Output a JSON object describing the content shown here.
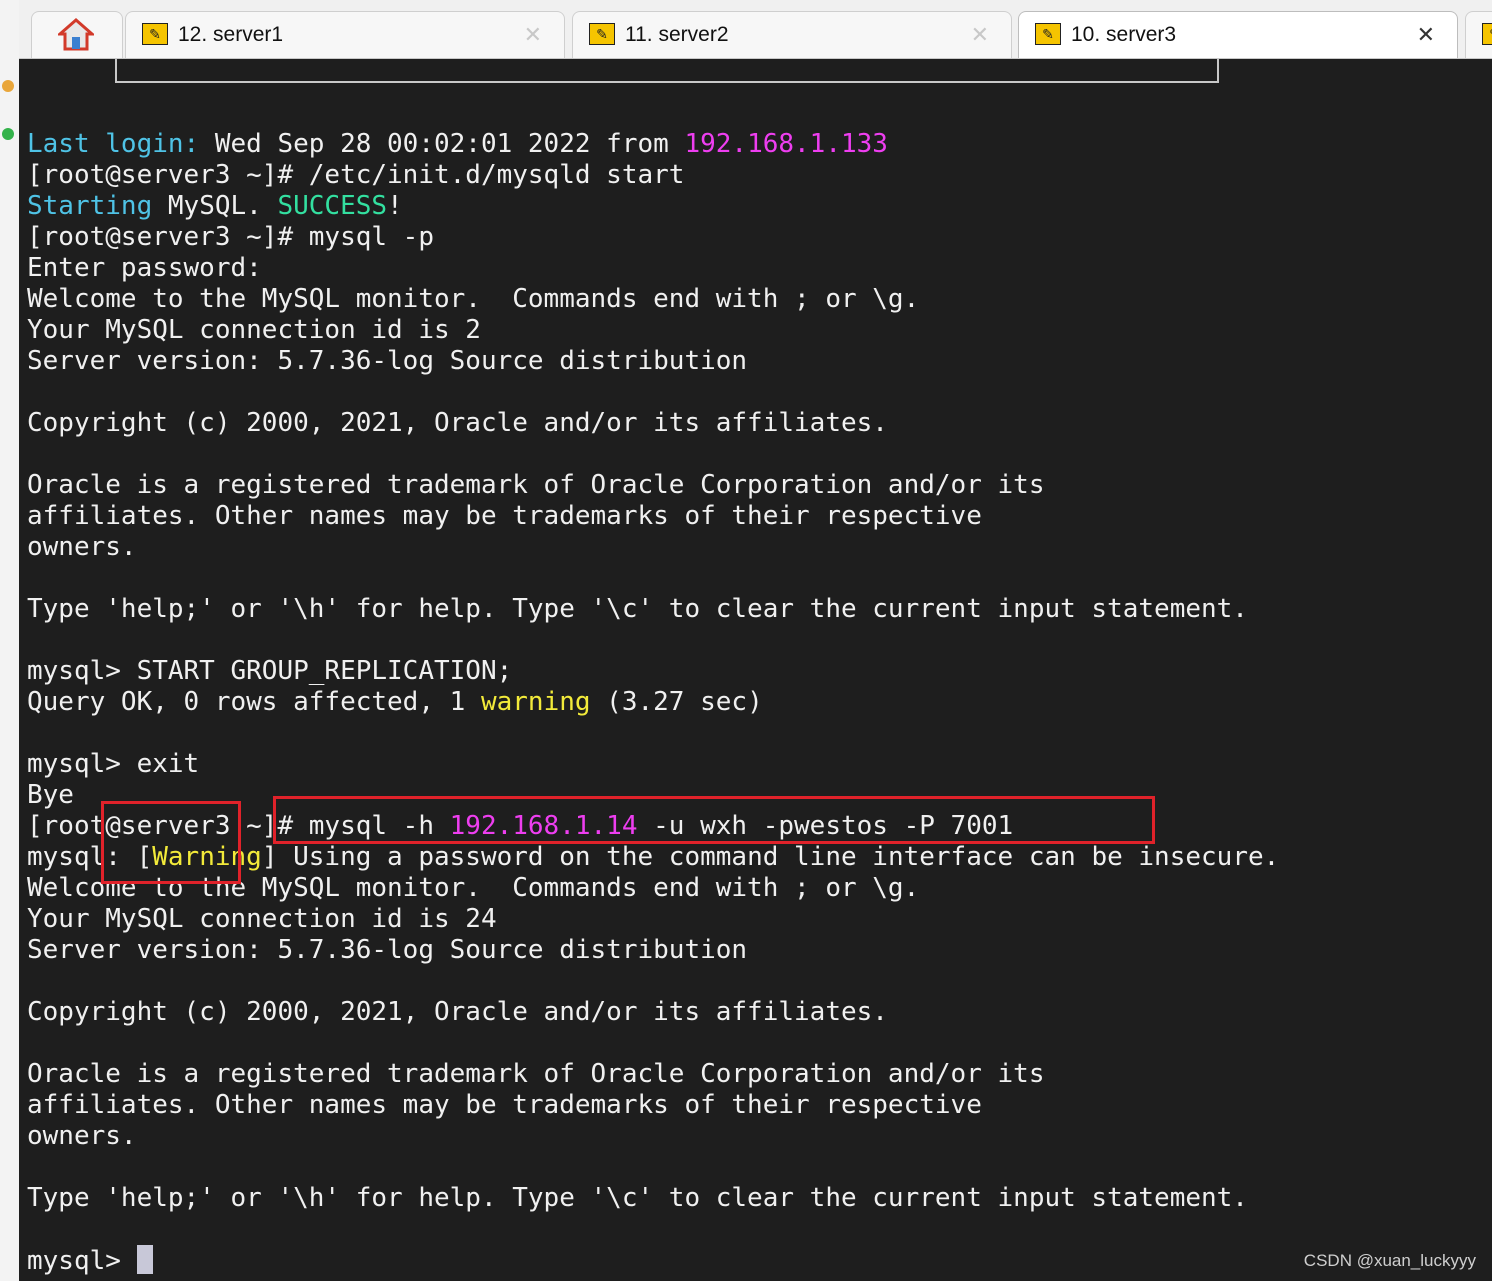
{
  "tabs": [
    {
      "label": "12. server1",
      "active": false
    },
    {
      "label": "11. server2",
      "active": false
    },
    {
      "label": "10. server3",
      "active": true
    }
  ],
  "icons": {
    "home": "home-icon",
    "tab": "key-icon",
    "close": "close-icon"
  },
  "colors": {
    "terminal_bg": "#1e1e1e",
    "text": "#f0f0f0",
    "cyan": "#4fc3e6",
    "magenta": "#ee3ef0",
    "green": "#33e0a0",
    "yellow": "#f2ea3a",
    "highlight": "#e0222a"
  },
  "terminal": {
    "lines": [
      [
        {
          "t": "Last login:",
          "c": "cyan"
        },
        {
          "t": " Wed Sep 28 00:02:01 2022 from "
        },
        {
          "t": "192.168.1.133",
          "c": "magenta"
        }
      ],
      [
        {
          "t": "[root@server3 ~]# /etc/init.d/mysqld start"
        }
      ],
      [
        {
          "t": "Starting",
          "c": "cyan"
        },
        {
          "t": " MySQL. "
        },
        {
          "t": "SUCCESS",
          "c": "green"
        },
        {
          "t": "!"
        }
      ],
      [
        {
          "t": "[root@server3 ~]# mysql -p"
        }
      ],
      [
        {
          "t": "Enter password:"
        }
      ],
      [
        {
          "t": "Welcome to the MySQL monitor.  Commands end with ; or \\g."
        }
      ],
      [
        {
          "t": "Your MySQL connection id is 2"
        }
      ],
      [
        {
          "t": "Server version: 5.7.36-log Source distribution"
        }
      ],
      [
        {
          "t": ""
        }
      ],
      [
        {
          "t": "Copyright (c) 2000, 2021, Oracle and/or its affiliates."
        }
      ],
      [
        {
          "t": ""
        }
      ],
      [
        {
          "t": "Oracle is a registered trademark of Oracle Corporation and/or its"
        }
      ],
      [
        {
          "t": "affiliates. Other names may be trademarks of their respective"
        }
      ],
      [
        {
          "t": "owners."
        }
      ],
      [
        {
          "t": ""
        }
      ],
      [
        {
          "t": "Type 'help;' or '\\h' for help. Type '\\c' to clear the current input statement."
        }
      ],
      [
        {
          "t": ""
        }
      ],
      [
        {
          "t": "mysql> START GROUP_REPLICATION;"
        }
      ],
      [
        {
          "t": "Query OK, 0 rows affected, 1 "
        },
        {
          "t": "warning",
          "c": "yellow"
        },
        {
          "t": " (3.27 sec)"
        }
      ],
      [
        {
          "t": ""
        }
      ],
      [
        {
          "t": "mysql> exit"
        }
      ],
      [
        {
          "t": "Bye"
        }
      ],
      [
        {
          "t": "[root@server3 ~]# mysql -h "
        },
        {
          "t": "192.168.1.14",
          "c": "magenta"
        },
        {
          "t": " -u wxh -pwestos -P 7001"
        }
      ],
      [
        {
          "t": "mysql: ["
        },
        {
          "t": "Warning",
          "c": "yellow"
        },
        {
          "t": "] Using a password on the command line interface can be insecure."
        }
      ],
      [
        {
          "t": "Welcome to the MySQL monitor.  Commands end with ; or \\g."
        }
      ],
      [
        {
          "t": "Your MySQL connection id is 24"
        }
      ],
      [
        {
          "t": "Server version: 5.7.36-log Source distribution"
        }
      ],
      [
        {
          "t": ""
        }
      ],
      [
        {
          "t": "Copyright (c) 2000, 2021, Oracle and/or its affiliates."
        }
      ],
      [
        {
          "t": ""
        }
      ],
      [
        {
          "t": "Oracle is a registered trademark of Oracle Corporation and/or its"
        }
      ],
      [
        {
          "t": "affiliates. Other names may be trademarks of their respective"
        }
      ],
      [
        {
          "t": "owners."
        }
      ],
      [
        {
          "t": ""
        }
      ],
      [
        {
          "t": "Type 'help;' or '\\h' for help. Type '\\c' to clear the current input statement."
        }
      ],
      [
        {
          "t": ""
        }
      ],
      [
        {
          "t": "mysql> "
        },
        {
          "cursor": true
        }
      ]
    ]
  },
  "watermark": "CSDN @xuan_luckyyy"
}
